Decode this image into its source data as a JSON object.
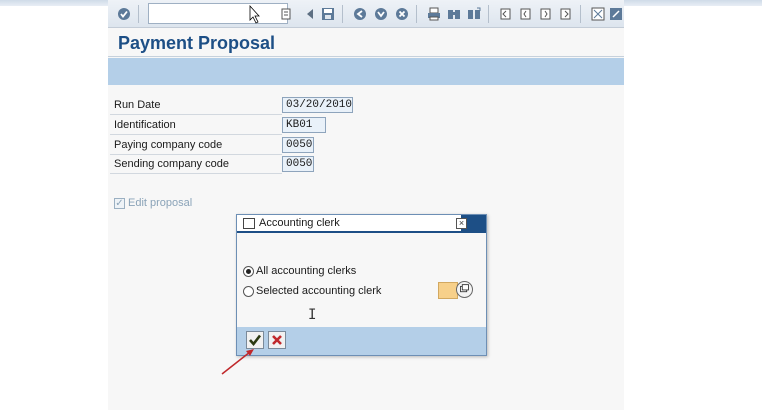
{
  "window": {
    "title": "Payment Proposal"
  },
  "toolbar": {
    "icons": [
      "enter-icon",
      "command-field",
      "save-icon",
      "back-icon",
      "exit-icon",
      "cancel-icon",
      "print-icon",
      "find-icon",
      "find-next-icon",
      "first-page-icon",
      "prev-page-icon",
      "next-page-icon",
      "last-page-icon",
      "layout-icon",
      "help-icon"
    ]
  },
  "form": {
    "fields": [
      {
        "label": "Run Date",
        "value": "03/20/2010"
      },
      {
        "label": "Identification",
        "value": "KB01"
      },
      {
        "label": "Paying company code",
        "value": "0050"
      },
      {
        "label": "Sending company code",
        "value": "0050"
      }
    ],
    "edit_proposal_label": "Edit proposal",
    "edit_proposal_checked": true
  },
  "dialog": {
    "title": "Accounting clerk",
    "options": [
      {
        "label": "All accounting clerks",
        "selected": true
      },
      {
        "label": "Selected accounting clerk",
        "selected": false
      }
    ],
    "confirm_icon": "checkmark-icon",
    "cancel_icon": "cancel-x-icon"
  },
  "colors": {
    "title_blue": "#1d4f86",
    "bar_blue": "#b4cfe8",
    "input_fill": "#e9f1f9",
    "required_input": "#f7d08a",
    "arrow_red": "#c0282b"
  }
}
